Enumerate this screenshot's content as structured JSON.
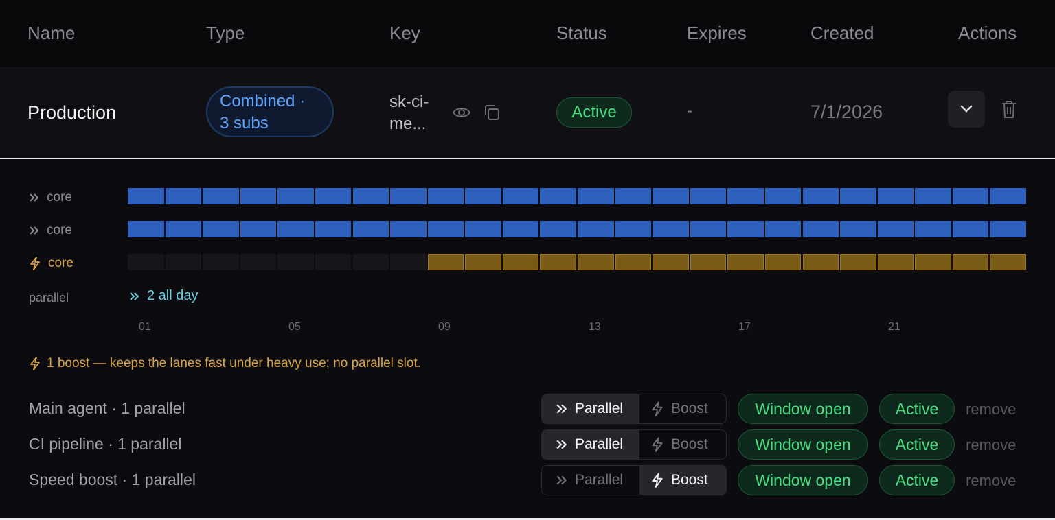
{
  "columns": [
    "Name",
    "Type",
    "Key",
    "Status",
    "Expires",
    "Created",
    "Actions"
  ],
  "row": {
    "name": "Production",
    "type_line1": "Combined ·",
    "type_line2": "3 subs",
    "key_line1": "sk-ci-",
    "key_line2": "me...",
    "status": "Active",
    "expires": "-",
    "created": "7/1/2026"
  },
  "lanes": [
    {
      "label": "core",
      "kind": "parallel",
      "color": "#2f5fbd",
      "empty_segments": 0,
      "filled_segments": 24
    },
    {
      "label": "core",
      "kind": "parallel",
      "color": "#2f5fbd",
      "empty_segments": 0,
      "filled_segments": 24
    },
    {
      "label": "core",
      "kind": "boost",
      "color": "#7a5c17",
      "empty_segments": 8,
      "filled_segments": 16
    }
  ],
  "parallel": {
    "label": "parallel",
    "summary": "2 all day"
  },
  "ticks": [
    "01",
    "05",
    "09",
    "13",
    "17",
    "21"
  ],
  "note": "1 boost — keeps the lanes fast under heavy use; no parallel slot.",
  "subs": [
    {
      "name": "Main agent · 1 parallel",
      "mode": "Parallel",
      "parallel_label": "Parallel",
      "boost_label": "Boost",
      "window": "Window open",
      "status": "Active",
      "remove": "remove"
    },
    {
      "name": "CI pipeline · 1 parallel",
      "mode": "Parallel",
      "parallel_label": "Parallel",
      "boost_label": "Boost",
      "window": "Window open",
      "status": "Active",
      "remove": "remove"
    },
    {
      "name": "Speed boost · 1 parallel",
      "mode": "Boost",
      "parallel_label": "Parallel",
      "boost_label": "Boost",
      "window": "Window open",
      "status": "Active",
      "remove": "remove"
    }
  ],
  "icons": {
    "key_reveal": "eye-icon",
    "key_copy": "copy-icon",
    "expand": "chevron-down-icon",
    "delete": "trash-icon",
    "parallel": "double-chevron-right-icon",
    "boost": "lightning-icon"
  },
  "colors": {
    "accent_blue": "#60a5fa",
    "success": "#4ade80",
    "boost": "#d9a441",
    "lane_blue": "#2f5fbd"
  }
}
